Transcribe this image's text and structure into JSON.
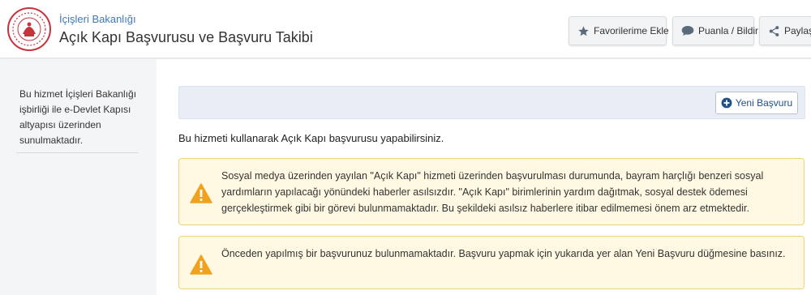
{
  "header": {
    "ministry": "İçişleri Bakanlığı",
    "title": "Açık Kapı Başvurusu ve Başvuru Takibi",
    "buttons": {
      "favorite": "Favorilerime Ekle",
      "rate": "Puanla / Bildir",
      "share": "Paylaş"
    }
  },
  "sidebar": {
    "info": "Bu hizmet İçişleri Bakanlığı işbirliği ile e-Devlet Kapısı altyapısı üzerinden sunulmaktadır."
  },
  "main": {
    "new_application_label": "Yeni Başvuru",
    "intro": "Bu hizmeti kullanarak Açık Kapı başvurusu yapabilirsiniz.",
    "alerts": [
      {
        "text": "Sosyal medya üzerinden yayılan \"Açık Kapı\" hizmeti üzerinden başvurulması durumunda, bayram harçlığı benzeri sosyal yardımların yapılacağı yönündeki haberler asılsızdır. \"Açık Kapı\" birimlerinin yardım dağıtmak, sosyal destek ödemesi gerçekleştirmek gibi bir görevi bulunmamaktadır. Bu şekildeki asılsız haberlere itibar edilmemesi önem arz etmektedir."
      },
      {
        "text": "Önceden yapılmış bir başvurunuz bulunmamaktadır. Başvuru yapmak için yukarıda yer alan Yeni Başvuru düğmesine basınız."
      }
    ]
  },
  "colors": {
    "link_blue": "#3f79b8",
    "alert_bg": "#fff8e2",
    "alert_border": "#f1d27a",
    "warning_orange": "#f0a21e",
    "toolbar_bg": "#e9eef6"
  },
  "icons": [
    "ministry-seal-logo",
    "star-icon",
    "comment-icon",
    "share-icon",
    "plus-circle-icon",
    "warning-icon"
  ]
}
